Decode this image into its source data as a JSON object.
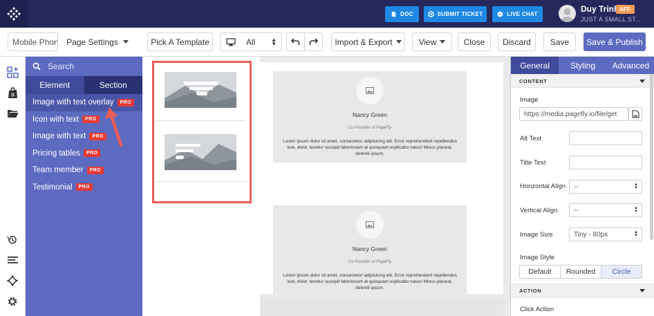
{
  "header": {
    "doc_label": "DOC",
    "ticket_label": "SUBMIT TICKET",
    "chat_label": "LIVE CHAT",
    "user_name": "Duy Trinh",
    "aff_badge": "AFF.",
    "shop_name": "JUST A SMALL ST..."
  },
  "toolbar": {
    "page_name": "Mobile Phone",
    "page_settings": "Page Settings",
    "pick_template": "Pick A Template",
    "device": "All",
    "import_export": "Import & Export",
    "view": "View",
    "close": "Close",
    "discard": "Discard",
    "save": "Save",
    "save_publish": "Save & Publish"
  },
  "panel": {
    "search_placeholder": "Search",
    "tab_element": "Element",
    "tab_section": "Section",
    "pro_label": "PRO",
    "items": [
      {
        "label": "Image with text overlay"
      },
      {
        "label": "Icon with text"
      },
      {
        "label": "Image with text"
      },
      {
        "label": "Pricing tables"
      },
      {
        "label": "Team member"
      },
      {
        "label": "Testimonial"
      }
    ]
  },
  "canvas": {
    "cards": [
      {
        "name": "Nancy Green",
        "role": "Co-Founder of PageFly",
        "text": "Lorem ipsum dolor sit amet, consectetur adipisicing elit. Error reprehenderit repellendus iure, dolor, tenetur suscipit laboriosam at quisquam explicabo natus! Minus placeat, deleniti ipsum."
      },
      {
        "name": "Nancy Green",
        "role": "Co-Founder of PageFly",
        "text": "Lorem ipsum dolor sit amet, consectetur adipisicing elit. Error reprehenderit repellendus iure, dolor, tenetur suscipit laboriosam at quisquam explicabo natus! Minus placeat, deleniti ipsum."
      }
    ]
  },
  "props": {
    "tab_general": "General",
    "tab_styling": "Styling",
    "tab_advanced": "Advanced",
    "content_head": "CONTENT",
    "image_label": "Image",
    "image_url": "https://media.pagefly.io/file/get",
    "alt_label": "Alt Text",
    "alt_value": "",
    "title_label": "Title Text",
    "title_value": "",
    "halign_label": "Horizontal Align",
    "halign_value": "--",
    "valign_label": "Vertical Align",
    "valign_value": "--",
    "size_label": "Image Size",
    "size_value": "Tiny - 80px",
    "style_label": "Image Style",
    "style_options": [
      "Default",
      "Rounded",
      "Circle"
    ],
    "style_selected": "Circle",
    "action_head": "ACTION",
    "click_action_label": "Click Action"
  },
  "colors": {
    "topbar": "#26285c",
    "accent": "#5c6bc0",
    "button_blue": "#1e88e5",
    "pro_red": "#e53935",
    "highlight": "#e95d55",
    "aff_orange": "#f39c53"
  }
}
